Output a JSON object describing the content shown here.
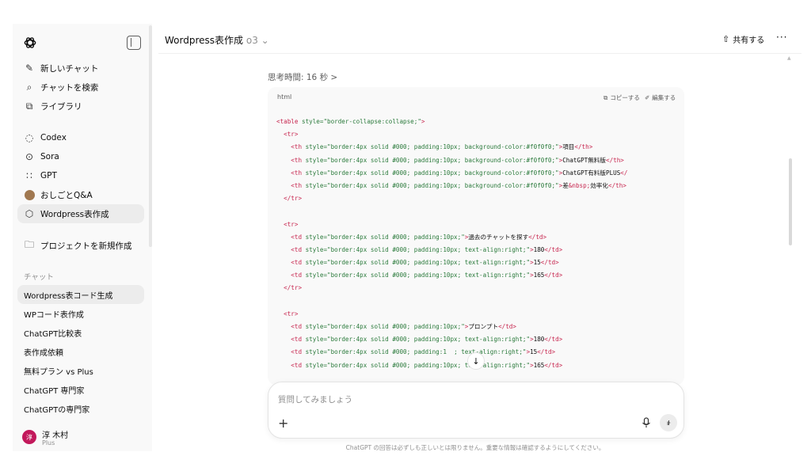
{
  "sidebar": {
    "top_items": [
      {
        "label": "新しいチャット",
        "icon": "edit-icon"
      },
      {
        "label": "チャットを検索",
        "icon": "search-icon"
      },
      {
        "label": "ライブラリ",
        "icon": "library-icon"
      }
    ],
    "app_items": [
      {
        "label": "Codex",
        "icon": "codex-icon"
      },
      {
        "label": "Sora",
        "icon": "sora-icon"
      },
      {
        "label": "GPT",
        "icon": "gpt-grid-icon"
      },
      {
        "label": "おしごとQ&A",
        "icon": "avatar-icon"
      },
      {
        "label": "Wordpress表作成",
        "icon": "cube-icon"
      }
    ],
    "new_project": "プロジェクトを新規作成",
    "chats_heading": "チャット",
    "chats": [
      "Wordpress表コード生成",
      "WPコード表作成",
      "ChatGPT比較表",
      "表作成依頼",
      "無料プラン vs Plus",
      "ChatGPT 専門家",
      "ChatGPTの専門家"
    ],
    "user": {
      "name": "淳 木村",
      "plan": "Plus",
      "initial": "淳"
    }
  },
  "header": {
    "title": "Wordpress表作成",
    "model": "o3",
    "share_label": "共有する",
    "more_label": "···"
  },
  "thinking": "思考時間: 16 秒 >",
  "code_block": {
    "language": "html",
    "copy_label": "コピーする",
    "edit_label": "編集する",
    "lines": [
      [
        [
          "tg",
          "<table"
        ],
        [
          "at",
          " style="
        ],
        [
          "sv",
          "\"border-collapse:collapse;\""
        ],
        [
          "tg",
          ">"
        ]
      ],
      [
        [
          "tx",
          "  "
        ],
        [
          "tg",
          "<tr>"
        ]
      ],
      [
        [
          "tx",
          "    "
        ],
        [
          "tg",
          "<th"
        ],
        [
          "at",
          " style="
        ],
        [
          "sv",
          "\"border:4px solid #000; padding:10px; background-color:#f0f0f0;\""
        ],
        [
          "tg",
          ">"
        ],
        [
          "tx",
          "項目"
        ],
        [
          "tg",
          "</th>"
        ]
      ],
      [
        [
          "tx",
          "    "
        ],
        [
          "tg",
          "<th"
        ],
        [
          "at",
          " style="
        ],
        [
          "sv",
          "\"border:4px solid #000; padding:10px; background-color:#f0f0f0;\""
        ],
        [
          "tg",
          ">"
        ],
        [
          "tx",
          "ChatGPT無料版"
        ],
        [
          "tg",
          "</th>"
        ]
      ],
      [
        [
          "tx",
          "    "
        ],
        [
          "tg",
          "<th"
        ],
        [
          "at",
          " style="
        ],
        [
          "sv",
          "\"border:4px solid #000; padding:10px; background-color:#f0f0f0;\""
        ],
        [
          "tg",
          ">"
        ],
        [
          "tx",
          "ChatGPT有料版PLUS"
        ],
        [
          "tg",
          "</"
        ]
      ],
      [
        [
          "tx",
          "    "
        ],
        [
          "tg",
          "<th"
        ],
        [
          "at",
          " style="
        ],
        [
          "sv",
          "\"border:4px solid #000; padding:10px; background-color:#f0f0f0;\""
        ],
        [
          "tg",
          ">"
        ],
        [
          "tx",
          "差"
        ],
        [
          "en",
          "&nbsp;"
        ],
        [
          "tx",
          "効率化"
        ],
        [
          "tg",
          "</th>"
        ]
      ],
      [
        [
          "tx",
          "  "
        ],
        [
          "tg",
          "</tr>"
        ]
      ],
      [
        [
          "tx",
          ""
        ]
      ],
      [
        [
          "tx",
          "  "
        ],
        [
          "tg",
          "<tr>"
        ]
      ],
      [
        [
          "tx",
          "    "
        ],
        [
          "tg",
          "<td"
        ],
        [
          "at",
          " style="
        ],
        [
          "sv",
          "\"border:4px solid #000; padding:10px;\""
        ],
        [
          "tg",
          ">"
        ],
        [
          "tx",
          "過去のチャットを探す"
        ],
        [
          "tg",
          "</td>"
        ]
      ],
      [
        [
          "tx",
          "    "
        ],
        [
          "tg",
          "<td"
        ],
        [
          "at",
          " style="
        ],
        [
          "sv",
          "\"border:4px solid #000; padding:10px; text-align:right;\""
        ],
        [
          "tg",
          ">"
        ],
        [
          "tx",
          "180"
        ],
        [
          "tg",
          "</td>"
        ]
      ],
      [
        [
          "tx",
          "    "
        ],
        [
          "tg",
          "<td"
        ],
        [
          "at",
          " style="
        ],
        [
          "sv",
          "\"border:4px solid #000; padding:10px; text-align:right;\""
        ],
        [
          "tg",
          ">"
        ],
        [
          "tx",
          "15"
        ],
        [
          "tg",
          "</td>"
        ]
      ],
      [
        [
          "tx",
          "    "
        ],
        [
          "tg",
          "<td"
        ],
        [
          "at",
          " style="
        ],
        [
          "sv",
          "\"border:4px solid #000; padding:10px; text-align:right;\""
        ],
        [
          "tg",
          ">"
        ],
        [
          "tx",
          "165"
        ],
        [
          "tg",
          "</td>"
        ]
      ],
      [
        [
          "tx",
          "  "
        ],
        [
          "tg",
          "</tr>"
        ]
      ],
      [
        [
          "tx",
          ""
        ]
      ],
      [
        [
          "tx",
          "  "
        ],
        [
          "tg",
          "<tr>"
        ]
      ],
      [
        [
          "tx",
          "    "
        ],
        [
          "tg",
          "<td"
        ],
        [
          "at",
          " style="
        ],
        [
          "sv",
          "\"border:4px solid #000; padding:10px;\""
        ],
        [
          "tg",
          ">"
        ],
        [
          "tx",
          "プロンプト"
        ],
        [
          "tg",
          "</td>"
        ]
      ],
      [
        [
          "tx",
          "    "
        ],
        [
          "tg",
          "<td"
        ],
        [
          "at",
          " style="
        ],
        [
          "sv",
          "\"border:4px solid #000; padding:10px; text-align:right;\""
        ],
        [
          "tg",
          ">"
        ],
        [
          "tx",
          "180"
        ],
        [
          "tg",
          "</td>"
        ]
      ],
      [
        [
          "tx",
          "    "
        ],
        [
          "tg",
          "<td"
        ],
        [
          "at",
          " style="
        ],
        [
          "sv",
          "\"border:4px solid #000; padding:1"
        ],
        [
          "tx",
          "  "
        ],
        [
          "sv",
          "; text-align:right;\""
        ],
        [
          "tg",
          ">"
        ],
        [
          "tx",
          "15"
        ],
        [
          "tg",
          "</td>"
        ]
      ],
      [
        [
          "tx",
          "    "
        ],
        [
          "tg",
          "<td"
        ],
        [
          "at",
          " style="
        ],
        [
          "sv",
          "\"border:4px solid #000; padding:10px; text-align:right;\""
        ],
        [
          "tg",
          ">"
        ],
        [
          "tx",
          "165"
        ],
        [
          "tg",
          "</td>"
        ]
      ]
    ]
  },
  "composer": {
    "placeholder": "質問してみましょう"
  },
  "disclaimer": "ChatGPT の回答は必ずしも正しいとは限りません。重要な情報は確認するようにしてください。"
}
